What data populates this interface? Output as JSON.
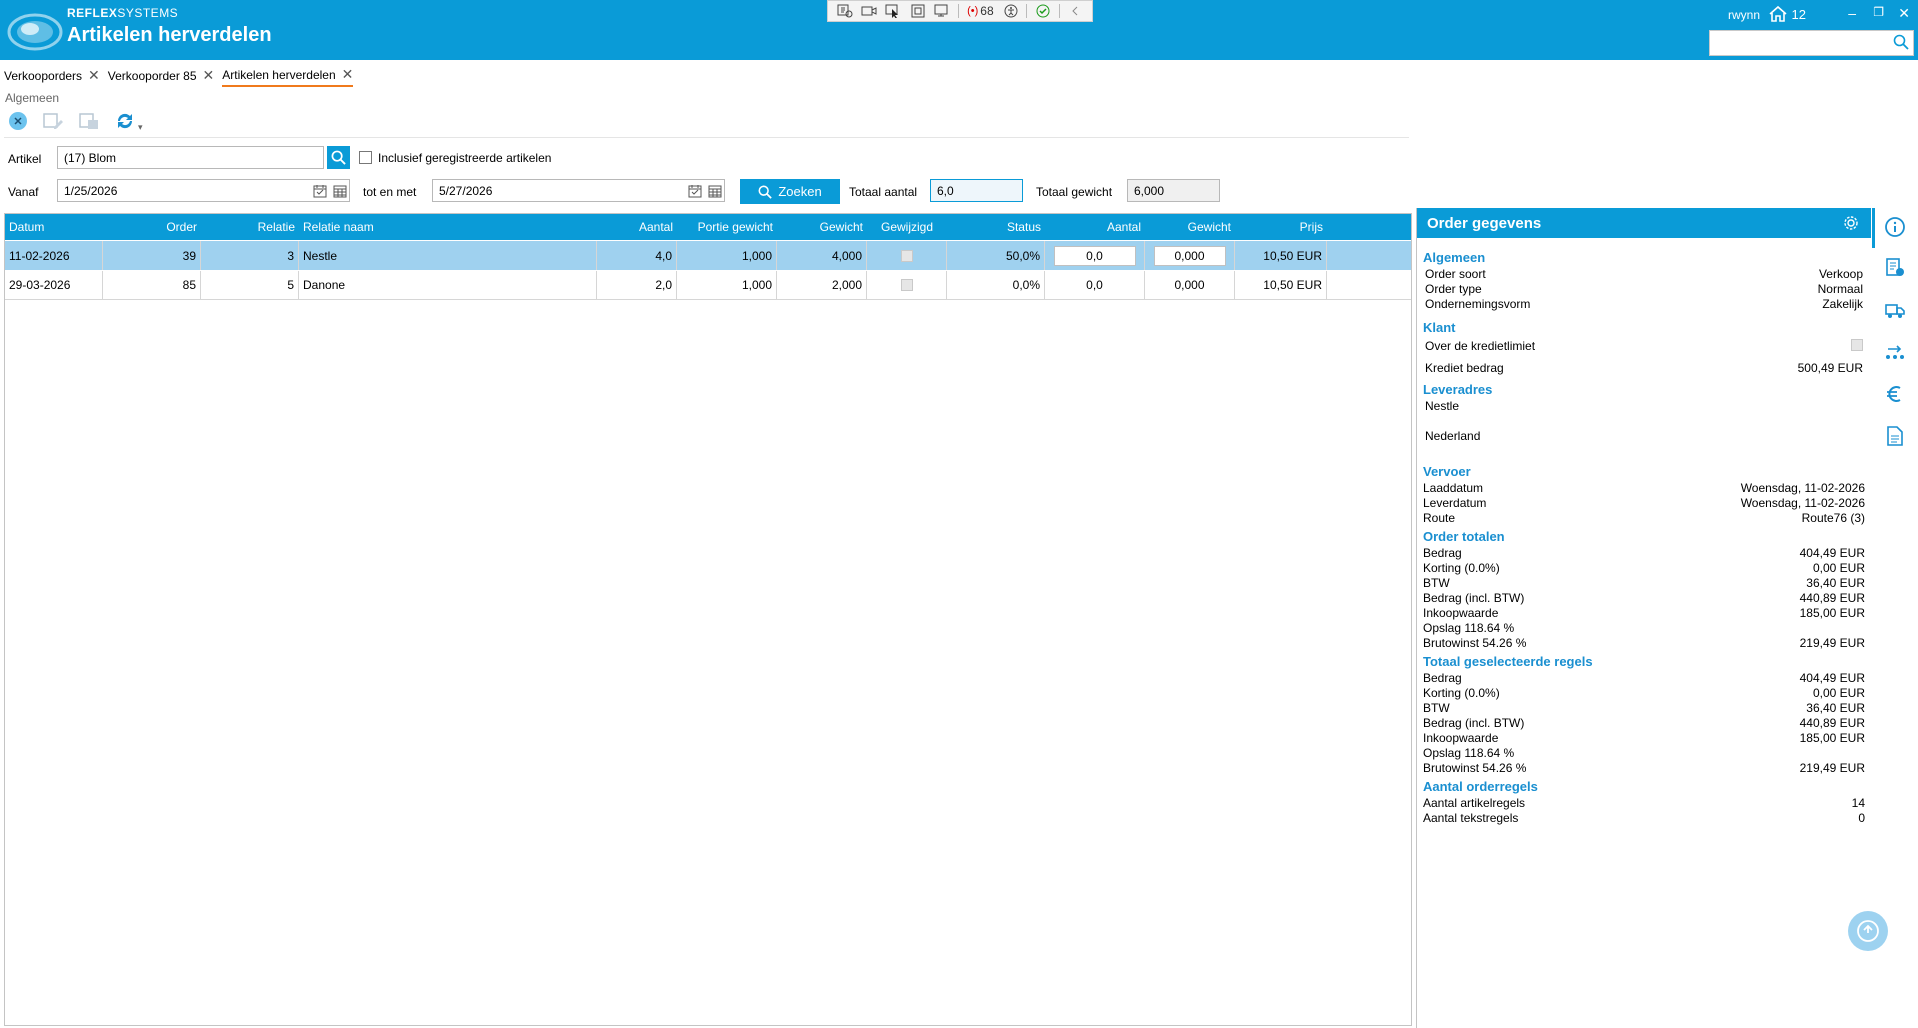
{
  "header": {
    "brand_bold": "REFLEX",
    "brand_rest": "SYSTEMS",
    "title": "Artikelen herverdelen",
    "user": "rwynn",
    "home_count": "12",
    "devbar_count": "68"
  },
  "tabs": [
    {
      "label": "Verkooporders"
    },
    {
      "label": "Verkooporder 85"
    },
    {
      "label": "Artikelen herverdelen"
    }
  ],
  "group_label": "Algemeen",
  "form": {
    "artikel_label": "Artikel",
    "artikel_value": "(17) Blom",
    "inclusief_label": "Inclusief geregistreerde artikelen",
    "vanaf_label": "Vanaf",
    "vanaf_value": "1/25/2026",
    "tot_label": "tot en met",
    "tot_value": "5/27/2026",
    "zoeken_label": "Zoeken",
    "totaal_aantal_label": "Totaal aantal",
    "totaal_aantal_value": "6,0",
    "totaal_gewicht_label": "Totaal gewicht",
    "totaal_gewicht_value": "6,000"
  },
  "grid": {
    "columns": [
      "Datum",
      "Order",
      "Relatie",
      "Relatie naam",
      "Aantal",
      "Portie gewicht",
      "Gewicht",
      "Gewijzigd",
      "Status",
      "Aantal",
      "Gewicht",
      "Prijs"
    ],
    "rows": [
      {
        "datum": "11-02-2026",
        "order": "39",
        "relatie": "3",
        "naam": "Nestle",
        "aantal": "4,0",
        "portie": "1,000",
        "gewicht": "4,000",
        "status": "50,0%",
        "aantal2": "0,0",
        "gewicht2": "0,000",
        "prijs": "10,50 EUR"
      },
      {
        "datum": "29-03-2026",
        "order": "85",
        "relatie": "5",
        "naam": "Danone",
        "aantal": "2,0",
        "portie": "1,000",
        "gewicht": "2,000",
        "status": "0,0%",
        "aantal2": "0,0",
        "gewicht2": "0,000",
        "prijs": "10,50 EUR"
      }
    ]
  },
  "panel": {
    "title": "Order gegevens",
    "algemeen": {
      "title": "Algemeen",
      "order_soort_label": "Order soort",
      "order_soort": "Verkoop",
      "order_type_label": "Order type",
      "order_type": "Normaal",
      "vorm_label": "Ondernemingsvorm",
      "vorm": "Zakelijk"
    },
    "klant": {
      "title": "Klant",
      "krediet_label": "Over de kredietlimiet",
      "bedrag_label": "Krediet bedrag",
      "bedrag": "500,49 EUR"
    },
    "leveradres": {
      "title": "Leveradres",
      "name": "Nestle",
      "country": "Nederland"
    },
    "vervoer": {
      "title": "Vervoer",
      "laad_label": "Laaddatum",
      "laad": "Woensdag, 11-02-2026",
      "lever_label": "Leverdatum",
      "lever": "Woensdag, 11-02-2026",
      "route_label": "Route",
      "route": "Route76 (3)"
    },
    "totalen": {
      "title": "Order totalen",
      "rows": [
        {
          "label": "Bedrag",
          "value": "404,49 EUR"
        },
        {
          "label": "Korting (0.0%)",
          "value": "0,00 EUR"
        },
        {
          "label": "BTW",
          "value": "36,40 EUR"
        },
        {
          "label": "Bedrag (incl. BTW)",
          "value": "440,89 EUR"
        },
        {
          "label": "Inkoopwaarde",
          "value": "185,00 EUR"
        },
        {
          "label": "Opslag 118.64 %",
          "value": ""
        },
        {
          "label": "Brutowinst 54.26 %",
          "value": "219,49 EUR"
        }
      ]
    },
    "geselecteerd": {
      "title": "Totaal geselecteerde regels",
      "rows": [
        {
          "label": "Bedrag",
          "value": "404,49 EUR"
        },
        {
          "label": "Korting (0.0%)",
          "value": "0,00 EUR"
        },
        {
          "label": "BTW",
          "value": "36,40 EUR"
        },
        {
          "label": "Bedrag (incl. BTW)",
          "value": "440,89 EUR"
        },
        {
          "label": "Inkoopwaarde",
          "value": "185,00 EUR"
        },
        {
          "label": "Opslag 118.64 %",
          "value": ""
        },
        {
          "label": "Brutowinst 54.26 %",
          "value": "219,49 EUR"
        }
      ]
    },
    "orderregels": {
      "title": "Aantal orderregels",
      "artikel_label": "Aantal artikelregels",
      "artikel": "14",
      "tekst_label": "Aantal tekstregels",
      "tekst": "0"
    }
  },
  "colors": {
    "accent": "#0a9bd7",
    "selected_row": "#9fd1ef",
    "tab_underline": "#f07a1c"
  }
}
